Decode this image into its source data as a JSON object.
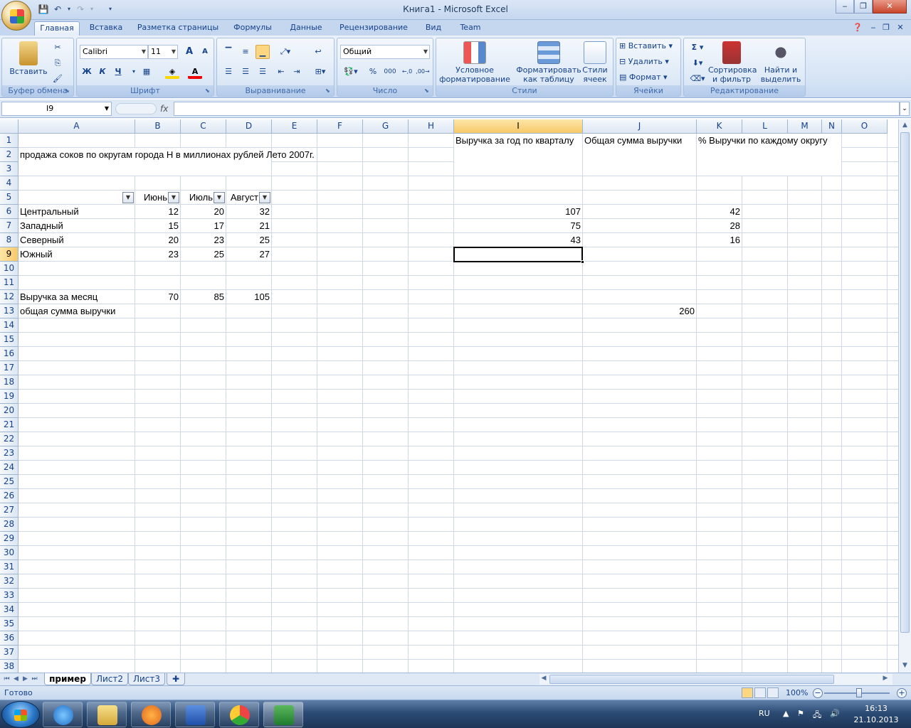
{
  "window": {
    "title": "Книга1 - Microsoft Excel"
  },
  "tabs": [
    "Главная",
    "Вставка",
    "Разметка страницы",
    "Формулы",
    "Данные",
    "Рецензирование",
    "Вид",
    "Team"
  ],
  "ribbon": {
    "clipboard": {
      "label": "Буфер обмена",
      "paste": "Вставить"
    },
    "font": {
      "label": "Шрифт",
      "name": "Calibri",
      "size": "11",
      "bold": "Ж",
      "italic": "К",
      "underline": "Ч",
      "grow": "A",
      "shrink": "A"
    },
    "alignment": {
      "label": "Выравнивание"
    },
    "number": {
      "label": "Число",
      "format": "Общий",
      "percent": "%",
      "thousands": "000"
    },
    "styles": {
      "label": "Стили",
      "conditional": "Условное форматирование",
      "as_table": "Форматировать как таблицу",
      "cell_styles": "Стили ячеек"
    },
    "cells": {
      "label": "Ячейки",
      "insert": "Вставить",
      "delete": "Удалить",
      "format": "Формат"
    },
    "editing": {
      "label": "Редактирование",
      "sum": "Σ",
      "sort": "Сортировка и фильтр",
      "find": "Найти и выделить"
    }
  },
  "formula_bar": {
    "name_box": "I9",
    "fx": "fx",
    "formula": ""
  },
  "columns": [
    "A",
    "B",
    "C",
    "D",
    "E",
    "F",
    "G",
    "H",
    "I",
    "J",
    "K",
    "L",
    "M",
    "N",
    "O"
  ],
  "rows": [
    "1",
    "2",
    "3",
    "4",
    "5",
    "6",
    "7",
    "8",
    "9",
    "10",
    "11",
    "12",
    "13",
    "14",
    "15",
    "16",
    "17",
    "18",
    "19",
    "20",
    "21",
    "22",
    "23",
    "24",
    "25",
    "26",
    "27",
    "28",
    "29",
    "30",
    "31",
    "32",
    "33",
    "34",
    "35",
    "36",
    "37",
    "38"
  ],
  "cells": {
    "A2": "продажа соков по округам города Н в миллионах рублей  Лето 2007г.",
    "B5": "Июнь",
    "C5": "Июль",
    "D5": "Август",
    "A6": "Центральный",
    "B6": "12",
    "C6": "20",
    "D6": "32",
    "A7": "Западный",
    "B7": "15",
    "C7": "17",
    "D7": "21",
    "A8": "Северный",
    "B8": "20",
    "C8": "23",
    "D8": "25",
    "A9": "Южный",
    "B9": "23",
    "C9": "25",
    "D9": "27",
    "A12": "Выручка за месяц",
    "B12": "70",
    "C12": "85",
    "D12": "105",
    "A13": "общая сумма выручки",
    "I1": "Выручка за год по кварталу",
    "J1": "Общая сумма выручки",
    "K1": "% Выручки по каждому округу",
    "I6": "107",
    "I7": "75",
    "I8": "43",
    "J13": "260",
    "K6": "42",
    "K7": "28",
    "K8": "16"
  },
  "selected_cell": "I9",
  "sheets": [
    "пример",
    "Лист2",
    "Лист3"
  ],
  "active_sheet": "пример",
  "status": {
    "text": "Готово",
    "zoom": "100%"
  },
  "taskbar": {
    "lang": "RU",
    "time": "16:13",
    "date": "21.10.2013"
  }
}
